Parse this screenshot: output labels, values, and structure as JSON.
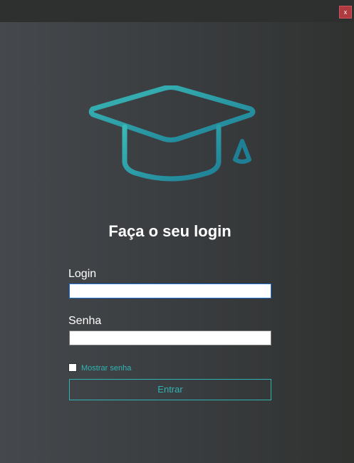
{
  "window": {
    "close_label": "x"
  },
  "login_form": {
    "title": "Faça o seu login",
    "login_label": "Login",
    "login_value": "",
    "password_label": "Senha",
    "password_value": "",
    "show_password_label": "Mostrar senha",
    "show_password_checked": false,
    "submit_label": "Entrar"
  },
  "colors": {
    "accent": "#2fb4b4",
    "close_button": "#b03a3f",
    "logo_gradient_start": "#3ab8b6",
    "logo_gradient_end": "#1e7f95"
  },
  "icons": {
    "logo": "graduation-cap-icon"
  }
}
